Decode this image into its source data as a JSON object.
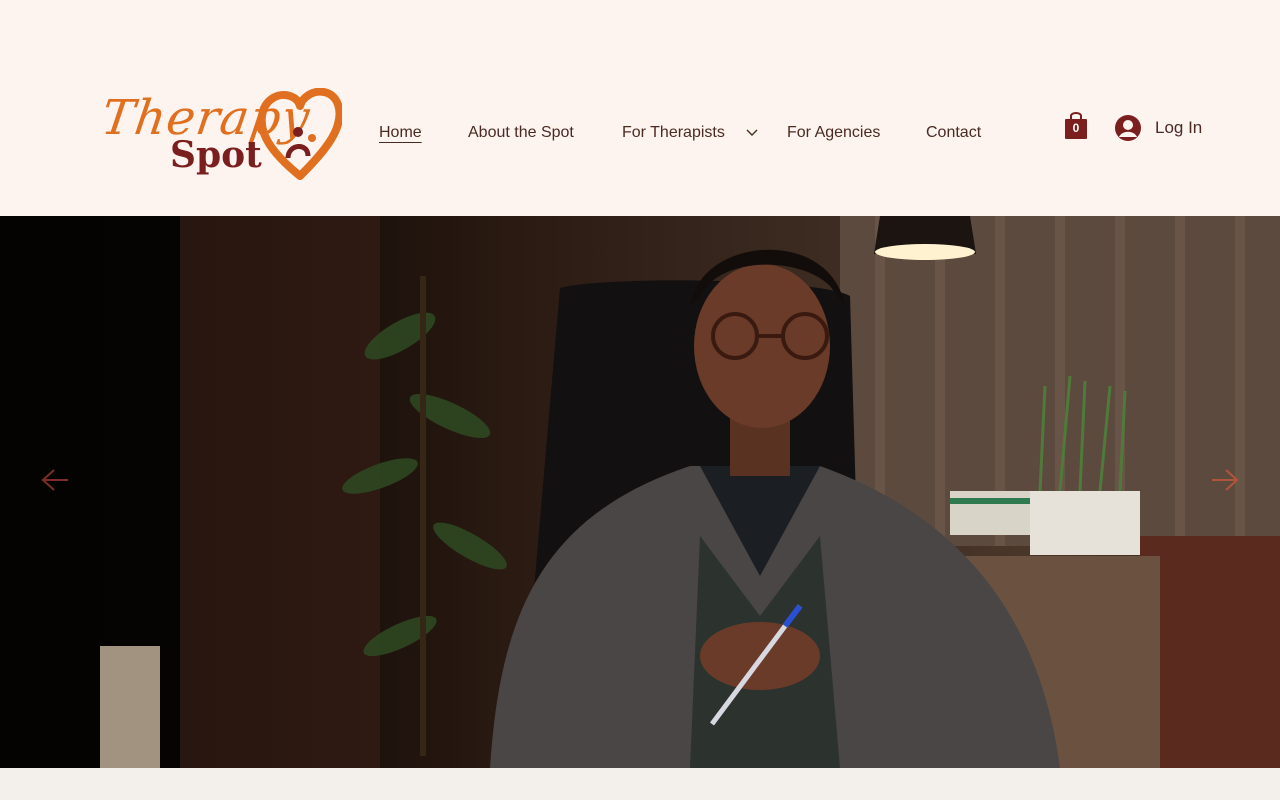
{
  "brand": {
    "logo_script": "Therapy",
    "logo_word": "Spot",
    "colors": {
      "orange": "#e0701f",
      "maroon": "#7a1e1e",
      "text": "#4a2a22",
      "background": "#fdf4ef"
    }
  },
  "nav": {
    "items": [
      {
        "label": "Home",
        "active": true
      },
      {
        "label": "About the Spot"
      },
      {
        "label": "For Therapists",
        "has_dropdown": true
      },
      {
        "label": "For Agencies"
      },
      {
        "label": "Contact"
      }
    ]
  },
  "cart": {
    "count": "0",
    "icon": "shopping-bag-icon"
  },
  "login": {
    "label": "Log In",
    "icon": "avatar-icon"
  },
  "hero": {
    "image": "therapist-seated-at-desk-photo",
    "prev_icon": "arrow-left-icon",
    "next_icon": "arrow-right-icon"
  }
}
